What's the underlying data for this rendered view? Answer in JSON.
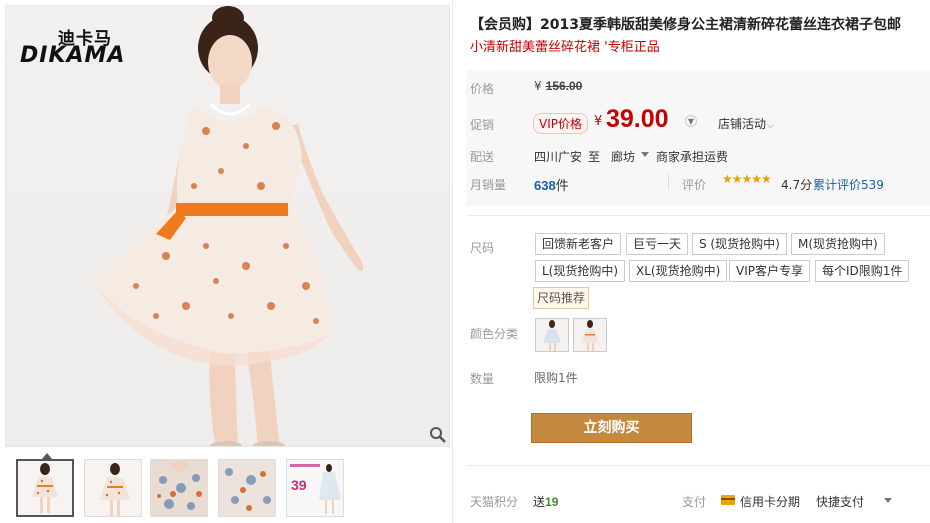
{
  "brand": {
    "cn": "迪卡马",
    "en": "DIKAMA"
  },
  "product": {
    "title": "【会员购】2013夏季韩版甜美修身公主裙清新碎花蕾丝连衣裙子包邮",
    "subtitle": "小清新甜美蕾丝碎花裙 '专柜正品"
  },
  "price": {
    "label": "价格",
    "currency": "¥",
    "original": "156.00"
  },
  "promo": {
    "label": "促销",
    "vip_tag": "VIP价格",
    "currency": "¥",
    "price": "39.00",
    "store_activity": "店铺活动"
  },
  "shipping": {
    "label": "配送",
    "from": "四川广安",
    "to_word": "至",
    "city": "廊坊",
    "fee": "商家承担运费"
  },
  "sales": {
    "label": "月销量",
    "count": "638",
    "unit": "件",
    "review_label": "评价",
    "stars": "★★★★★",
    "score": "4.7分",
    "review_count": "累计评价539"
  },
  "size": {
    "label": "尺码",
    "options": [
      "回馈新老客户",
      "巨亏一天",
      "S (现货抢购中)",
      "M(现货抢购中)",
      "L(现货抢购中)",
      "XL(现货抢购中)",
      "VIP客户专享",
      "每个ID限购1件"
    ],
    "recommend": "尺码推荐"
  },
  "color": {
    "label": "颜色分类"
  },
  "quantity": {
    "label": "数量",
    "limit": "限购1件"
  },
  "buy_button": "立刻购买",
  "tmall_points": {
    "label": "天猫积分",
    "prefix": "送",
    "value": "19"
  },
  "payment": {
    "label": "支付",
    "credit": "信用卡分期",
    "quick": "快捷支付"
  },
  "colors": {
    "accent_red": "#c40000",
    "buy_button": "#c5883f",
    "link_blue": "#1a5ea8"
  },
  "icons": [
    "zoom-icon",
    "chevron-down-icon",
    "credit-card-icon",
    "caret-down-icon"
  ]
}
